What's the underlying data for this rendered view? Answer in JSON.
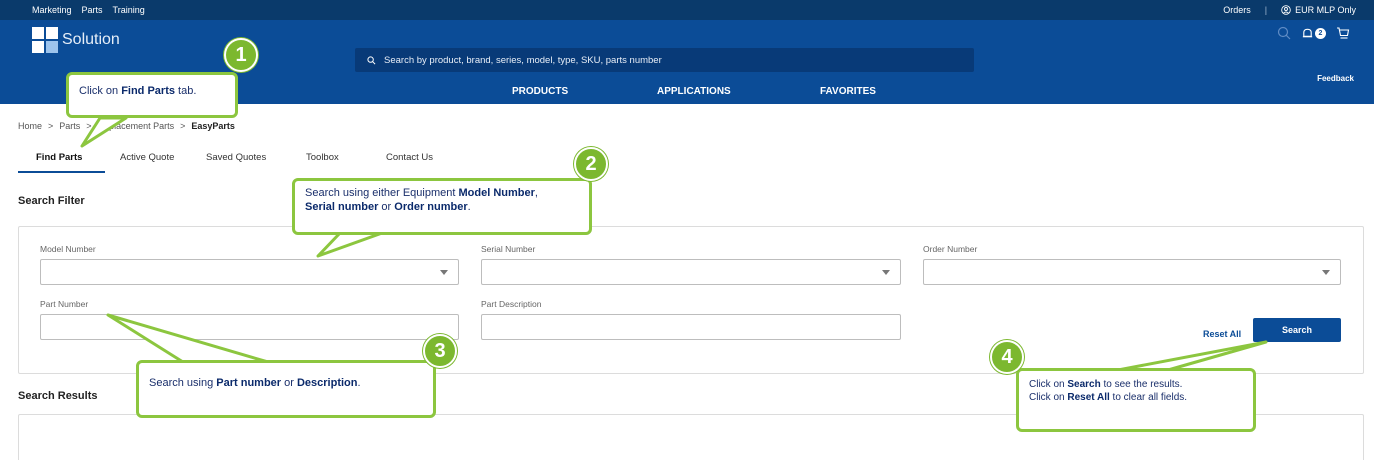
{
  "topbar": {
    "links": [
      "Marketing",
      "Parts",
      "Training"
    ],
    "orders": "Orders",
    "separator": "|",
    "account": "EUR MLP Only"
  },
  "header": {
    "logo_text": "Solution",
    "search_placeholder": "Search by product, brand, series, model, type, SKU, parts number",
    "nav": [
      "PRODUCTS",
      "APPLICATIONS",
      "FAVORITES"
    ],
    "notification_count": "2",
    "feedback": "Feedback"
  },
  "breadcrumb": {
    "home": "Home",
    "parts": "Parts",
    "replacement": "Replacement Parts",
    "current": "EasyParts",
    "sep": ">"
  },
  "tabs": [
    "Find Parts",
    "Active Quote",
    "Saved Quotes",
    "Toolbox",
    "Contact Us"
  ],
  "search_filter": {
    "title": "Search Filter",
    "model_label": "Model Number",
    "serial_label": "Serial Number",
    "order_label": "Order Number",
    "part_number_label": "Part Number",
    "part_desc_label": "Part Description",
    "reset_label": "Reset All",
    "search_label": "Search"
  },
  "search_results": {
    "title": "Search Results"
  },
  "callouts": {
    "c1": {
      "number": "1",
      "pre": "Click on ",
      "bold": "Find Parts",
      "post": " tab."
    },
    "c2": {
      "number": "2",
      "line1_pre": "Search using either Equipment ",
      "line1_bold": "Model Number",
      "line1_post": ",",
      "line2_bold1": "Serial number",
      "line2_mid": " or ",
      "line2_bold2": "Order number",
      "line2_post": "."
    },
    "c3": {
      "number": "3",
      "pre": "Search using ",
      "bold1": "Part number",
      "mid": " or ",
      "bold2": "Description",
      "post": "."
    },
    "c4": {
      "number": "4",
      "l1_pre": "Click on ",
      "l1_bold": "Search",
      "l1_post": " to see the results.",
      "l2_pre": "Click on ",
      "l2_bold": "Reset All",
      "l2_post": " to clear all fields."
    }
  },
  "colors": {
    "brand_blue": "#0b4c97",
    "top_strip": "#0a3a6b",
    "callout_green": "#8cc63f"
  }
}
